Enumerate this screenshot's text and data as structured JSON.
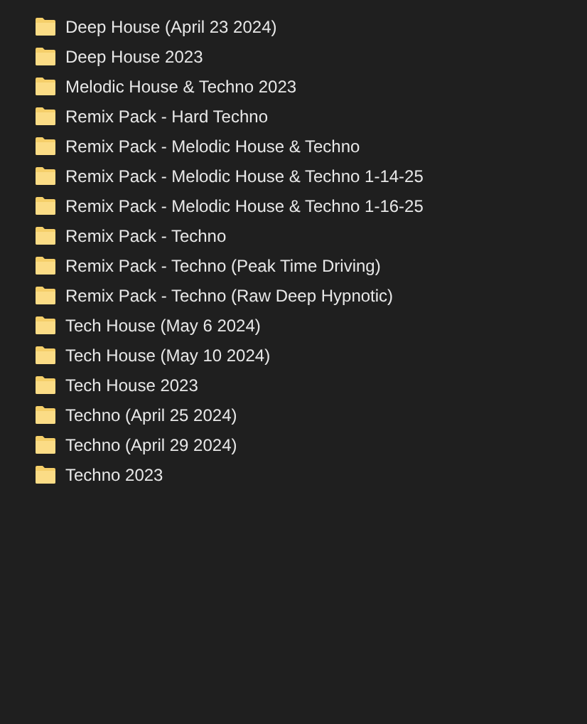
{
  "folders": [
    {
      "name": "Deep House (April 23 2024)"
    },
    {
      "name": "Deep House 2023"
    },
    {
      "name": "Melodic House & Techno 2023"
    },
    {
      "name": "Remix Pack - Hard Techno"
    },
    {
      "name": "Remix Pack - Melodic House & Techno"
    },
    {
      "name": "Remix Pack - Melodic House & Techno 1-14-25"
    },
    {
      "name": "Remix Pack - Melodic House & Techno 1-16-25"
    },
    {
      "name": "Remix Pack - Techno"
    },
    {
      "name": "Remix Pack - Techno (Peak Time Driving)"
    },
    {
      "name": "Remix Pack - Techno (Raw Deep Hypnotic)"
    },
    {
      "name": "Tech House (May 6 2024)"
    },
    {
      "name": "Tech House (May 10 2024)"
    },
    {
      "name": "Tech House 2023"
    },
    {
      "name": "Techno (April 25 2024)"
    },
    {
      "name": "Techno (April 29 2024)"
    },
    {
      "name": "Techno 2023"
    }
  ]
}
